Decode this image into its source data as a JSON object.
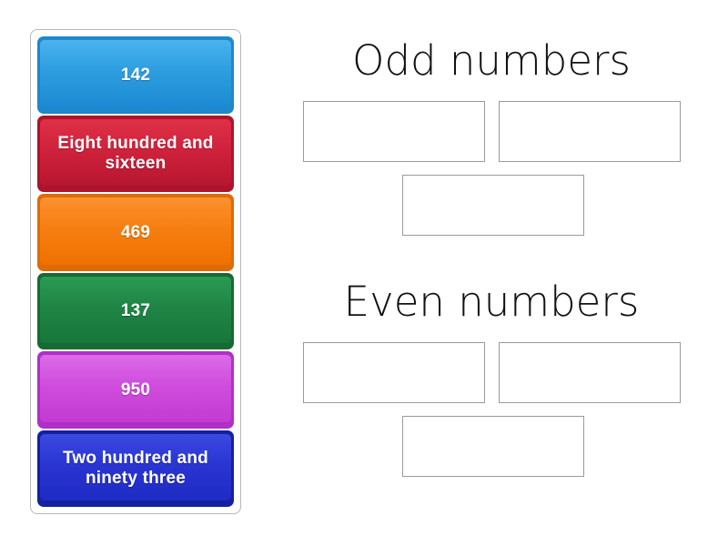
{
  "activity": {
    "type": "group-sort",
    "cards_panel_label": "draggable cards"
  },
  "cards": [
    {
      "text": "142",
      "color": "#2e9ee0",
      "color_name": "blue",
      "value": 142
    },
    {
      "text": "Eight hundred and sixteen",
      "color": "#d0223c",
      "color_name": "red",
      "value": 816
    },
    {
      "text": "469",
      "color": "#f67f11",
      "color_name": "orange",
      "value": 469
    },
    {
      "text": "137",
      "color": "#1f8545",
      "color_name": "green",
      "value": 137
    },
    {
      "text": "950",
      "color": "#cf4ddd",
      "color_name": "magenta",
      "value": 950
    },
    {
      "text": "Two hundred and ninety three",
      "color": "#2a35d2",
      "color_name": "navy",
      "value": 293
    }
  ],
  "categories": [
    {
      "title": "Odd numbers",
      "dropzones": [
        {
          "label": "",
          "position": "left"
        },
        {
          "label": "",
          "position": "right"
        },
        {
          "label": "",
          "position": "bottom"
        }
      ]
    },
    {
      "title": "Even numbers",
      "dropzones": [
        {
          "label": "",
          "position": "left"
        },
        {
          "label": "",
          "position": "right"
        },
        {
          "label": "",
          "position": "bottom"
        }
      ]
    }
  ]
}
